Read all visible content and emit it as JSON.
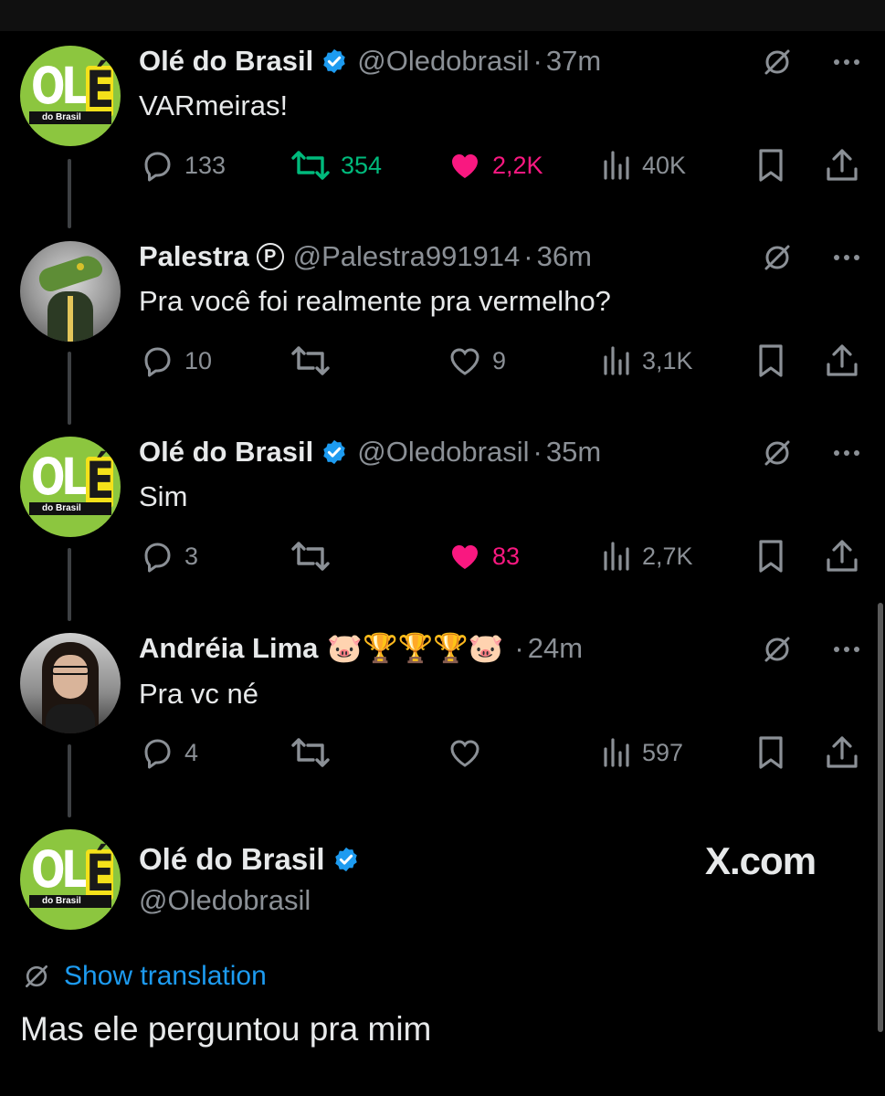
{
  "tweets": [
    {
      "name": "Olé do Brasil",
      "verified": true,
      "handle": "@Oledobrasil",
      "time": "37m",
      "text": "VARmeiras!",
      "replies": "133",
      "retweets": "354",
      "retweeted": true,
      "likes": "2,2K",
      "liked": true,
      "views": "40K",
      "avatar": "ole-do-brasil-logo"
    },
    {
      "name": "Palestra",
      "badge": "P",
      "handle": "@Palestra991914",
      "time": "36m",
      "text": "Pra você foi realmente pra vermelho?",
      "replies": "10",
      "retweets": "",
      "likes": "9",
      "liked": false,
      "views": "3,1K",
      "avatar": "crocodile-in-suit"
    },
    {
      "name": "Olé do Brasil",
      "verified": true,
      "handle": "@Oledobrasil",
      "time": "35m",
      "text": "Sim",
      "replies": "3",
      "retweets": "",
      "likes": "83",
      "liked": true,
      "views": "2,7K",
      "avatar": "ole-do-brasil-logo"
    },
    {
      "name": "Andréia Lima",
      "emojis": "🐷🏆🏆🏆🐷",
      "time": "24m",
      "text": "Pra vc né",
      "replies": "4",
      "retweets": "",
      "likes": "",
      "liked": false,
      "views": "597",
      "avatar": "woman-with-glasses"
    }
  ],
  "main_tweet": {
    "name": "Olé do Brasil",
    "verified": true,
    "handle": "@Oledobrasil",
    "watermark": "X.com",
    "translate_label": "Show translation",
    "text": "Mas ele perguntou pra mim"
  },
  "avatar_logo": {
    "ole": "OL",
    "e": "É",
    "sub": "do Brasil"
  },
  "colors": {
    "background": "#000000",
    "text": "#e7e9ea",
    "muted": "#8b9096",
    "link": "#1d9bf0",
    "like": "#f91880",
    "retweet": "#00ba7c",
    "verified": "#1d9bf0"
  }
}
